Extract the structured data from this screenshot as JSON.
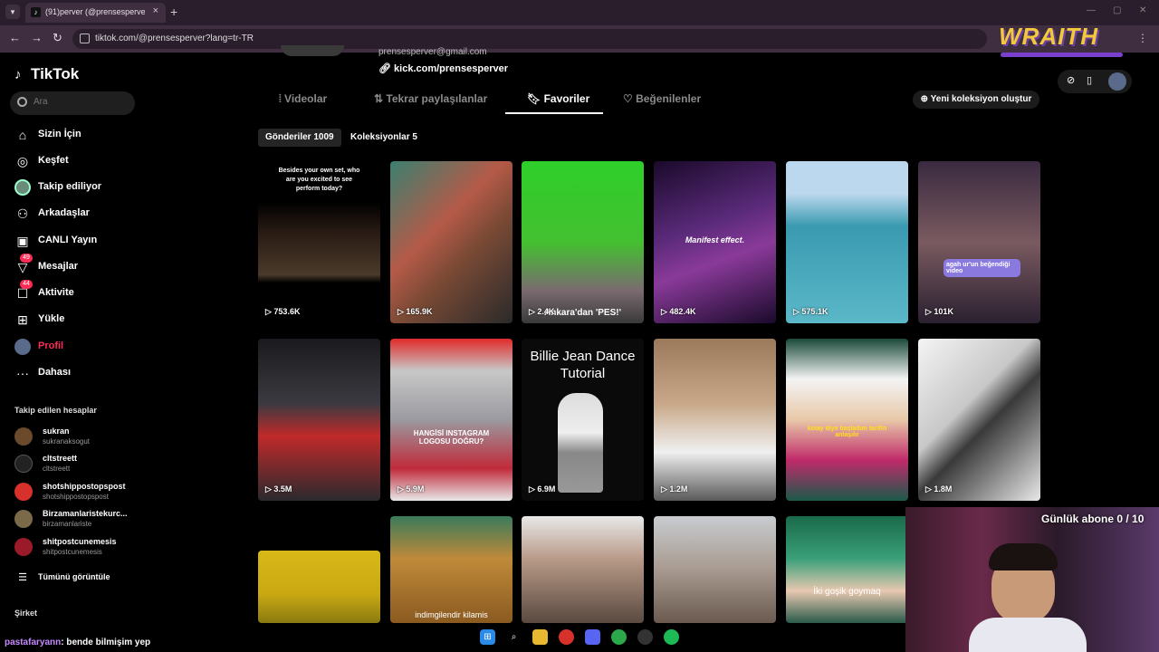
{
  "browser": {
    "tab_title": "(91)perver (@prensesperver) | TikTok",
    "url": "tiktok.com/@prensesperver?lang=tr-TR"
  },
  "sidebar": {
    "logo": "TikTok",
    "search_placeholder": "Ara",
    "items": [
      {
        "label": "Sizin İçin",
        "icon": "home-icon"
      },
      {
        "label": "Keşfet",
        "icon": "compass-icon"
      },
      {
        "label": "Takip ediliyor",
        "icon": "following-avatar-icon"
      },
      {
        "label": "Arkadaşlar",
        "icon": "friends-icon"
      },
      {
        "label": "CANLI Yayın",
        "icon": "live-icon"
      },
      {
        "label": "Mesajlar",
        "icon": "messages-icon",
        "badge": "49"
      },
      {
        "label": "Aktivite",
        "icon": "activity-icon",
        "badge": "44"
      },
      {
        "label": "Yükle",
        "icon": "upload-icon"
      },
      {
        "label": "Profil",
        "icon": "profile-avatar-icon"
      },
      {
        "label": "Dahası",
        "icon": "more-icon"
      }
    ],
    "following_title": "Takip edilen hesaplar",
    "following": [
      {
        "name": "sukran",
        "user": "sukranaksogut"
      },
      {
        "name": "cltstreett",
        "user": "cltstreett"
      },
      {
        "name": "shotshippostopspost",
        "user": "shotshippostopspost"
      },
      {
        "name": "Birzamanlaristekurc...",
        "user": "birzamanlariste"
      },
      {
        "name": "shitpostcunemesis",
        "user": "shitpostcunemesis"
      }
    ],
    "see_all": "Tümünü görüntüle",
    "company": "Şirket"
  },
  "profile": {
    "email_partial": "prensesperver@gmail.com",
    "link": "kick.com/prensesperver",
    "tabs": [
      "Videolar",
      "Tekrar paylaşılanlar",
      "Favoriler",
      "Beğenilenler"
    ],
    "active_tab": "Favoriler",
    "new_collection": "Yeni koleksiyon oluştur",
    "subtabs": [
      "Gönderiler 1009",
      "Koleksiyonlar 5"
    ]
  },
  "videos": [
    {
      "views": "753.6K",
      "text": "Besides your own set, who are you excited to see perform today?",
      "bg": "#1a1410"
    },
    {
      "views": "165.9K",
      "text": "",
      "bg": "#7a4a35"
    },
    {
      "views": "2.4K",
      "text": "Ankara'dan 'PES!'",
      "bg": "#3fbf2a"
    },
    {
      "views": "482.4K",
      "text": "Manifest effect.",
      "bg": "#3b1d63"
    },
    {
      "views": "575.1K",
      "text": "",
      "bg": "#4aa3b8"
    },
    {
      "views": "101K",
      "text": "agah ur'un beğendiği video",
      "bg": "#5a4150"
    },
    {
      "views": "3.5M",
      "text": "",
      "bg": "#2a2a2e"
    },
    {
      "views": "5.9M",
      "text": "HANGİSİ INSTAGRAM LOGOSU DOĞRU?",
      "bg": "#8a2a2a"
    },
    {
      "views": "6.9M",
      "text": "Billie Jean Dance Tutorial",
      "bg": "#111111"
    },
    {
      "views": "1.2M",
      "text": "",
      "bg": "#4a3a30"
    },
    {
      "views": "",
      "text": "kolay diye başladım tarifin anlaşılır",
      "bg": "#2f6b4a"
    },
    {
      "views": "1.8M",
      "text": "",
      "bg": "#d8d8d8"
    },
    {
      "views": "",
      "text": "",
      "bg": "#c9a812"
    },
    {
      "views": "",
      "text": "indimgilendir kilamis",
      "bg": "#8a5a20"
    },
    {
      "views": "",
      "text": "",
      "bg": "#7a6a60"
    },
    {
      "views": "",
      "text": "",
      "bg": "#c8ccd0"
    },
    {
      "views": "",
      "text": "İki goşik goymaq",
      "bg": "#2a7a5a"
    }
  ],
  "stream": {
    "brand": "WRAITH",
    "sub_goal": "Günlük abone 0 / 10",
    "chat_user": "pastafaryann",
    "chat_msg": ": bende bilmişim yep"
  },
  "colors": {
    "accent": "#fe2c55",
    "bg": "#000000",
    "browser": "#3f2d40"
  }
}
